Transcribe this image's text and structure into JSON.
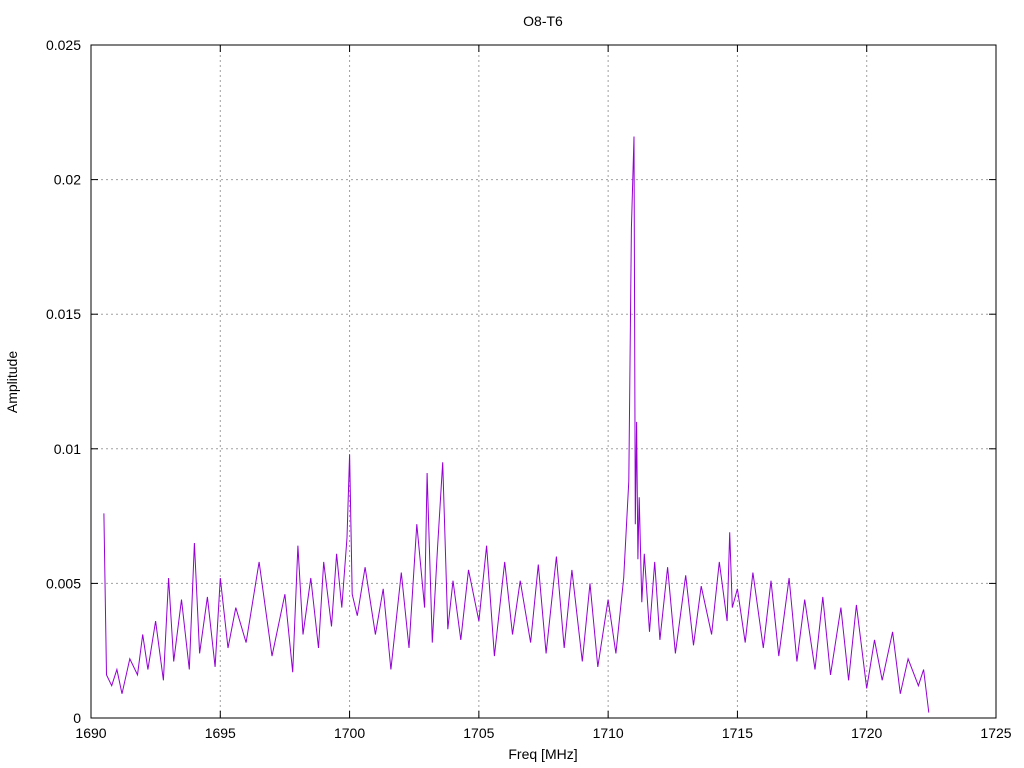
{
  "chart_data": {
    "type": "line",
    "title": "O8-T6",
    "xlabel": "Freq [MHz]",
    "ylabel": "Amplitude",
    "xlim": [
      1690,
      1725
    ],
    "ylim": [
      0,
      0.025
    ],
    "xticks": [
      1690,
      1695,
      1700,
      1705,
      1710,
      1715,
      1720,
      1725
    ],
    "xtick_labels": [
      "1690",
      "1695",
      "1700",
      "1705",
      "1710",
      "1715",
      "1720",
      "1725"
    ],
    "yticks": [
      0,
      0.005,
      0.01,
      0.015,
      0.02,
      0.025
    ],
    "ytick_labels": [
      "0",
      "0.005",
      "0.01",
      "0.015",
      "0.02",
      "0.025"
    ],
    "grid": true,
    "line_color": "#9400d3",
    "series": [
      {
        "x": [
          1690.5,
          1690.6,
          1690.8,
          1691.0,
          1691.2,
          1691.5,
          1691.8,
          1692.0,
          1692.2,
          1692.5,
          1692.8,
          1693.0,
          1693.2,
          1693.5,
          1693.8,
          1694.0,
          1694.2,
          1694.5,
          1694.8,
          1695.0,
          1695.3,
          1695.6,
          1696.0,
          1696.5,
          1697.0,
          1697.5,
          1697.8,
          1698.0,
          1698.2,
          1698.5,
          1698.8,
          1699.0,
          1699.3,
          1699.5,
          1699.7,
          1699.9,
          1700.0,
          1700.1,
          1700.3,
          1700.6,
          1701.0,
          1701.3,
          1701.6,
          1702.0,
          1702.3,
          1702.6,
          1702.9,
          1703.0,
          1703.2,
          1703.4,
          1703.6,
          1703.8,
          1704.0,
          1704.3,
          1704.6,
          1705.0,
          1705.3,
          1705.6,
          1706.0,
          1706.3,
          1706.6,
          1707.0,
          1707.3,
          1707.6,
          1708.0,
          1708.3,
          1708.6,
          1709.0,
          1709.3,
          1709.6,
          1710.0,
          1710.3,
          1710.6,
          1710.8,
          1710.9,
          1711.0,
          1711.05,
          1711.1,
          1711.15,
          1711.2,
          1711.3,
          1711.4,
          1711.6,
          1711.8,
          1712.0,
          1712.3,
          1712.6,
          1713.0,
          1713.3,
          1713.6,
          1714.0,
          1714.3,
          1714.6,
          1714.7,
          1714.8,
          1715.0,
          1715.3,
          1715.6,
          1716.0,
          1716.3,
          1716.6,
          1717.0,
          1717.3,
          1717.6,
          1718.0,
          1718.3,
          1718.6,
          1719.0,
          1719.3,
          1719.6,
          1720.0,
          1720.3,
          1720.6,
          1721.0,
          1721.3,
          1721.6,
          1722.0,
          1722.2,
          1722.4
        ],
        "y": [
          0.0076,
          0.0016,
          0.0012,
          0.0018,
          0.0009,
          0.0022,
          0.0016,
          0.0031,
          0.0018,
          0.0036,
          0.0014,
          0.0052,
          0.0021,
          0.0044,
          0.0018,
          0.0065,
          0.0024,
          0.0045,
          0.0019,
          0.0052,
          0.0026,
          0.0041,
          0.0028,
          0.0058,
          0.0023,
          0.0046,
          0.0017,
          0.0064,
          0.0031,
          0.0052,
          0.0026,
          0.0058,
          0.0034,
          0.0061,
          0.0041,
          0.0067,
          0.0098,
          0.0046,
          0.0038,
          0.0056,
          0.0031,
          0.0048,
          0.0018,
          0.0054,
          0.0026,
          0.0072,
          0.0041,
          0.0091,
          0.0028,
          0.0063,
          0.0095,
          0.0033,
          0.0051,
          0.0029,
          0.0055,
          0.0036,
          0.0064,
          0.0023,
          0.0058,
          0.0031,
          0.0051,
          0.0028,
          0.0057,
          0.0024,
          0.006,
          0.0026,
          0.0055,
          0.0021,
          0.005,
          0.0019,
          0.0044,
          0.0024,
          0.0052,
          0.0088,
          0.0182,
          0.0216,
          0.0072,
          0.011,
          0.0059,
          0.0082,
          0.0043,
          0.0061,
          0.0032,
          0.0058,
          0.0029,
          0.0056,
          0.0024,
          0.0053,
          0.0027,
          0.0049,
          0.0031,
          0.0058,
          0.0036,
          0.0069,
          0.0041,
          0.0048,
          0.0028,
          0.0054,
          0.0026,
          0.0051,
          0.0023,
          0.0052,
          0.0021,
          0.0044,
          0.0018,
          0.0045,
          0.0016,
          0.0041,
          0.0014,
          0.0042,
          0.0011,
          0.0029,
          0.0014,
          0.0032,
          0.0009,
          0.0022,
          0.0012,
          0.0018,
          0.0002
        ]
      }
    ]
  }
}
